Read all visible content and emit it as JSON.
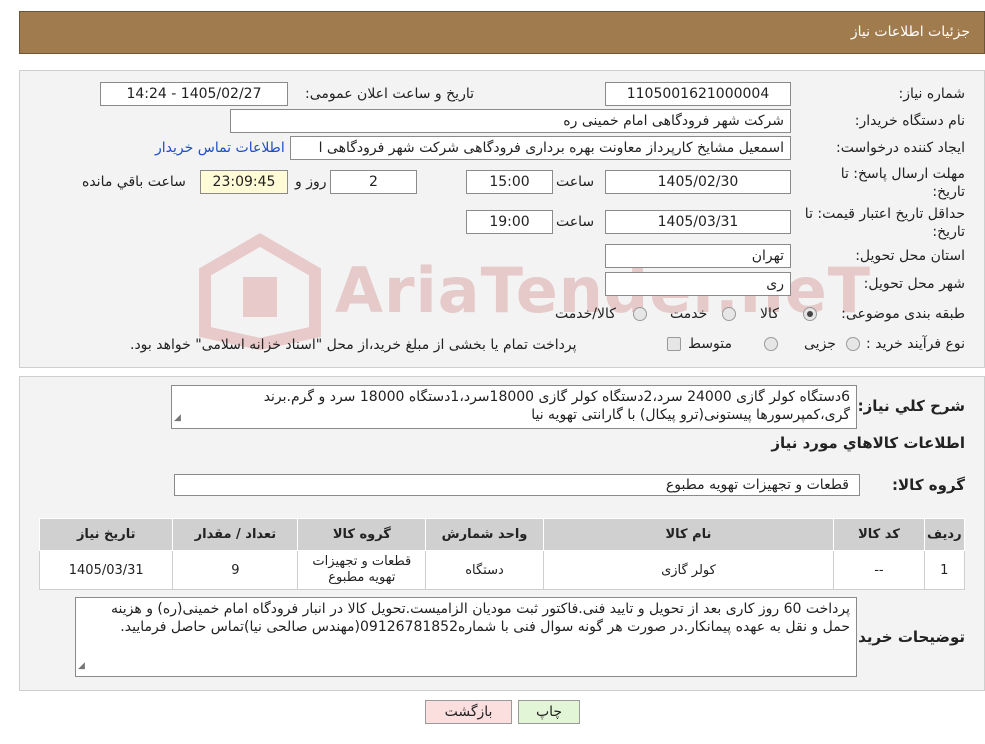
{
  "header": {
    "title": "جزئیات اطلاعات نیاز"
  },
  "watermark": {
    "text": "AriaTender.neT"
  },
  "form": {
    "need_number_label": "شماره نیاز:",
    "need_number": "1105001621000004",
    "announce_label": "تاریخ و ساعت اعلان عمومی:",
    "announce_value": "1405/02/27 - 14:24",
    "buyer_org_label": "نام دستگاه خریدار:",
    "buyer_org": "شرکت شهر فرودگاهی امام خمینی  ره",
    "creator_label": "ایجاد کننده درخواست:",
    "creator": "اسمعیل مشایخ کارپرداز معاونت بهره برداری فرودگاهی شرکت شهر فرودگاهی ا",
    "contact_link": "اطلاعات تماس خریدار",
    "reply_deadline_label_1": "مهلت ارسال پاسخ: تا",
    "reply_deadline_label_2": "تاریخ:",
    "reply_date": "1405/02/30",
    "time_label": "ساعت",
    "reply_time": "15:00",
    "days_value": "2",
    "days_label": "روز و",
    "remaining_value": "23:09:45",
    "remaining_label": "ساعت باقي مانده",
    "validity_label_1": "حداقل تاریخ اعتبار قیمت: تا",
    "validity_label_2": "تاریخ:",
    "validity_date": "1405/03/31",
    "validity_time": "19:00",
    "province_label": "استان محل تحویل:",
    "province": "تهران",
    "city_label": "شهر محل تحویل:",
    "city": "ری",
    "category_label": "طبقه بندی موضوعی:",
    "category_options": [
      "کالا",
      "خدمت",
      "کالا/خدمت"
    ],
    "category_selected": "کالا",
    "purchase_label": "نوع فرآیند خرید :",
    "purchase_options": [
      "جزیی",
      "متوسط"
    ],
    "purchase_note": "پرداخت تمام یا بخشی از مبلغ خرید،از محل \"اسناد خزانه اسلامی\" خواهد بود."
  },
  "summary": {
    "label": "شرح کلي نياز:",
    "text": "6دستگاه کولر گازی 24000 سرد،2دستگاه کولر گازی 18000سرد،1دستگاه 18000 سرد و گرم.برند گری،کمپرسورها پیستونی(ترو پیکال) با گارانتی تهویه نیا"
  },
  "goods": {
    "section_title": "اطلاعات کالاهاي مورد نياز",
    "group_label": "گروه کالا:",
    "group_value": "قطعات و تجهیزات تهویه مطبوع",
    "columns": [
      "ردیف",
      "کد کالا",
      "نام کالا",
      "واحد شمارش",
      "گروه کالا",
      "تعداد / مقدار",
      "تاریخ نیاز"
    ],
    "rows": [
      {
        "row": "1",
        "code": "--",
        "name": "کولر گازی",
        "unit": "دستگاه",
        "group": "قطعات و تجهیزات تهویه مطبوع",
        "qty": "9",
        "date": "1405/03/31"
      }
    ]
  },
  "buyer_notes": {
    "label": "توضیحات خریدار:",
    "text": "پرداخت 60 روز کاری بعد از تحویل و تایید فنی.فاکتور ثبت مودیان الزامیست.تحویل کالا در انبار فرودگاه امام خمینی(ره) و هزینه حمل و نقل به عهده پیمانکار.در صورت هر گونه سوال فنی با شماره09126781852(مهندس صالحی نیا)تماس حاصل فرمایید."
  },
  "buttons": {
    "print": "چاپ",
    "back": "بازگشت"
  },
  "colors": {
    "header_bg": "#a07b4e",
    "panel_bg": "#f3f3f3",
    "remaining_bg": "#fffbd6",
    "print_bg": "#e2f5d6",
    "back_bg": "#fbdede",
    "link": "#1a4fc8"
  }
}
